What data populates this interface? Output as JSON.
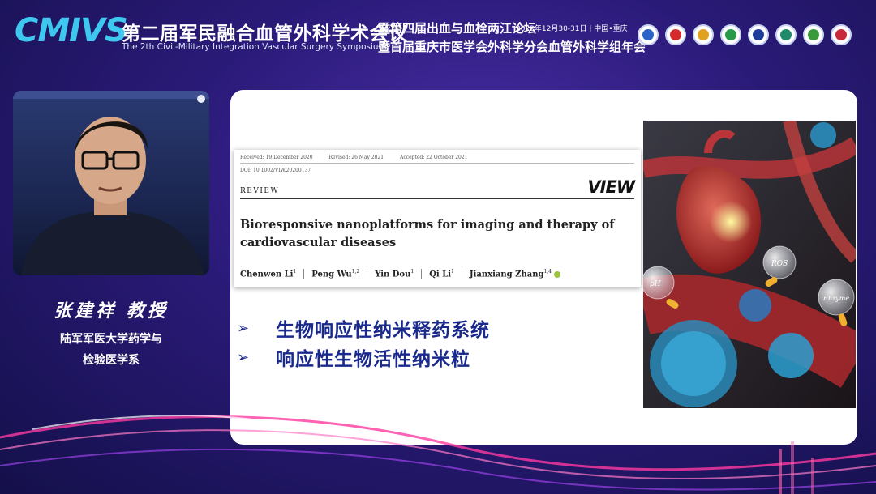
{
  "header": {
    "logo": "CMIVS",
    "title_cn": "第二届军民融合血管外科学术会议",
    "title_en": "The 2th Civil-Military Integration Vascular Surgery Symposium",
    "subtitle_1": "暨第四届出血与血栓两江论坛",
    "date_location": "2022年12月30-31日 | 中国•重庆",
    "subtitle_2": "暨首届重庆市医学会外科学分会血管外科学组年会",
    "emblems": [
      "emblem-1",
      "emblem-2",
      "emblem-3",
      "emblem-4",
      "emblem-5",
      "emblem-6",
      "emblem-7",
      "emblem-8"
    ]
  },
  "speaker": {
    "name": "张建祥 教授",
    "affiliation_line1": "陆军军医大学药学与",
    "affiliation_line2": "检验医学系"
  },
  "slide": {
    "paper": {
      "received": "Received: 19 December 2020",
      "revised": "Revised: 26 May 2021",
      "accepted": "Accepted: 22 October 2021",
      "doi": "DOI: 10.1002/VIW.20200137",
      "section": "REVIEW",
      "journal": "VIEW",
      "title": "Bioresponsive nanoplatforms for imaging and therapy of cardiovascular diseases",
      "authors": [
        {
          "name": "Chenwen Li",
          "sup": "1"
        },
        {
          "name": "Peng Wu",
          "sup": "1,2"
        },
        {
          "name": "Yin Dou",
          "sup": "1"
        },
        {
          "name": "Qi Li",
          "sup": "1"
        },
        {
          "name": "Jianxiang Zhang",
          "sup": "1,4"
        }
      ]
    },
    "bullets": [
      {
        "marker": "➢",
        "text": "生物响应性纳米释药系统"
      },
      {
        "marker": "➢",
        "text": "响应性生物活性纳米粒"
      }
    ],
    "illustration_labels": {
      "ros": "ROS",
      "ph": "pH",
      "enzyme": "Enzyme"
    }
  },
  "colors": {
    "logo": "#3ec8f0",
    "bullet_text": "#1a2a8c",
    "background_center": "#4a2fa8",
    "background_edge": "#14104a"
  }
}
